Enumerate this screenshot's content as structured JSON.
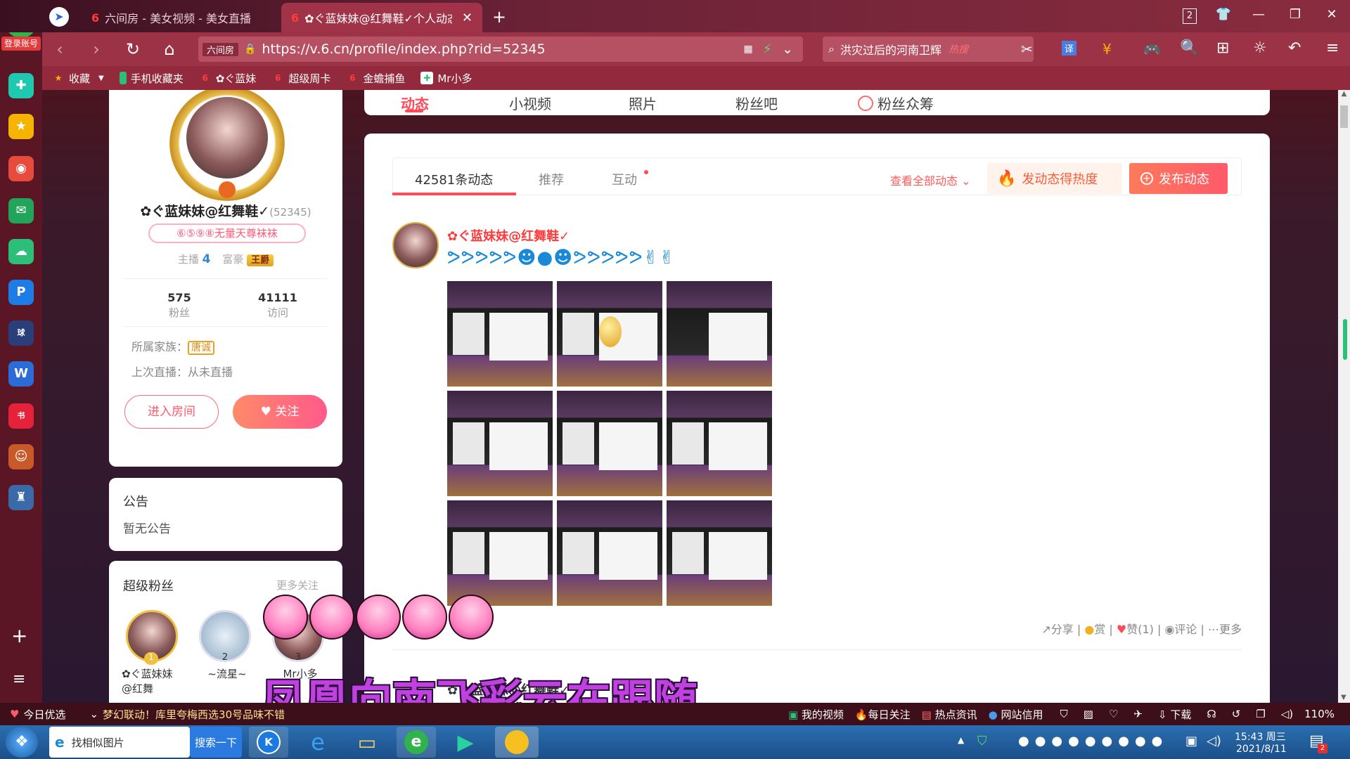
{
  "browser": {
    "tabs": [
      {
        "label": "六间房 - 美女视频 - 美女直播"
      },
      {
        "label": "✿ぐ蓝妹妹@红舞鞋✓个人动态"
      }
    ],
    "tab_count": "2",
    "url": "https://v.6.cn/profile/index.php?rid=52345",
    "url_badge": "六间房",
    "search_text": "洪灾过后的河南卫辉",
    "search_hot": "热搜",
    "login_label": "登录账号"
  },
  "bookmarks": [
    {
      "label": "收藏"
    },
    {
      "label": "手机收藏夹"
    },
    {
      "label": "✿ぐ蓝妹"
    },
    {
      "label": "超级周卡"
    },
    {
      "label": "金蟾捕鱼"
    },
    {
      "label": "Mr小多"
    }
  ],
  "profile_tabs": [
    "动态",
    "小视频",
    "照片",
    "粉丝吧",
    "粉丝众筹"
  ],
  "profile": {
    "name": "✿ぐ蓝妹妹@红舞鞋✓",
    "rid": "(52345)",
    "badge": "⑥⑤⑨⑧无量天尊袜袜",
    "anchor_label": "主播",
    "anchor_level": "4",
    "rich_label": "富豪",
    "rich_level": "王爵",
    "fans_count": "575",
    "fans_label": "粉丝",
    "visits_count": "41111",
    "visits_label": "访问",
    "family_label": "所属家族：",
    "family_value": "唐诚",
    "last_live": "上次直播：从未直播",
    "enter_room": "进入房间",
    "follow": "关注"
  },
  "notice": {
    "title": "公告",
    "content": "暂无公告"
  },
  "superfans": {
    "title": "超级粉丝",
    "more": "更多关注",
    "fans": [
      {
        "rank": "1",
        "name": "✿ぐ蓝妹妹@红舞"
      },
      {
        "rank": "2",
        "name": "~流星~"
      },
      {
        "rank": "3",
        "name": "Mr小多"
      }
    ]
  },
  "feed": {
    "tabs": [
      {
        "label": "42581条动态"
      },
      {
        "label": "推荐"
      },
      {
        "label": "互动"
      }
    ],
    "view_all": "查看全部动态",
    "hot_btn": "发动态得热度",
    "post_btn": "发布动态",
    "post_author": "✿ぐ蓝妹妹@红舞鞋✓",
    "actions": {
      "share": "分享",
      "reward": "赏",
      "like": "赞(1)",
      "comment": "评论",
      "more": "更多"
    },
    "second_author": "✿ぐ蓝妹妹@红舞鞋✓"
  },
  "overlay_text": "凤凰向南飞彩云在跟随",
  "statusbar": {
    "today": "今日优选",
    "ad": "梦幻联动！库里夸梅西选30号品味不错",
    "my_video": "我的视频",
    "daily": "每日关注",
    "news": "热点资讯",
    "credit": "网站信用",
    "download": "下载",
    "zoom": "110%"
  },
  "taskbar": {
    "find_image": "找相似图片",
    "search_btn": "搜索一下",
    "time": "15:43 周三",
    "date": "2021/8/11",
    "notify_count": "2"
  }
}
